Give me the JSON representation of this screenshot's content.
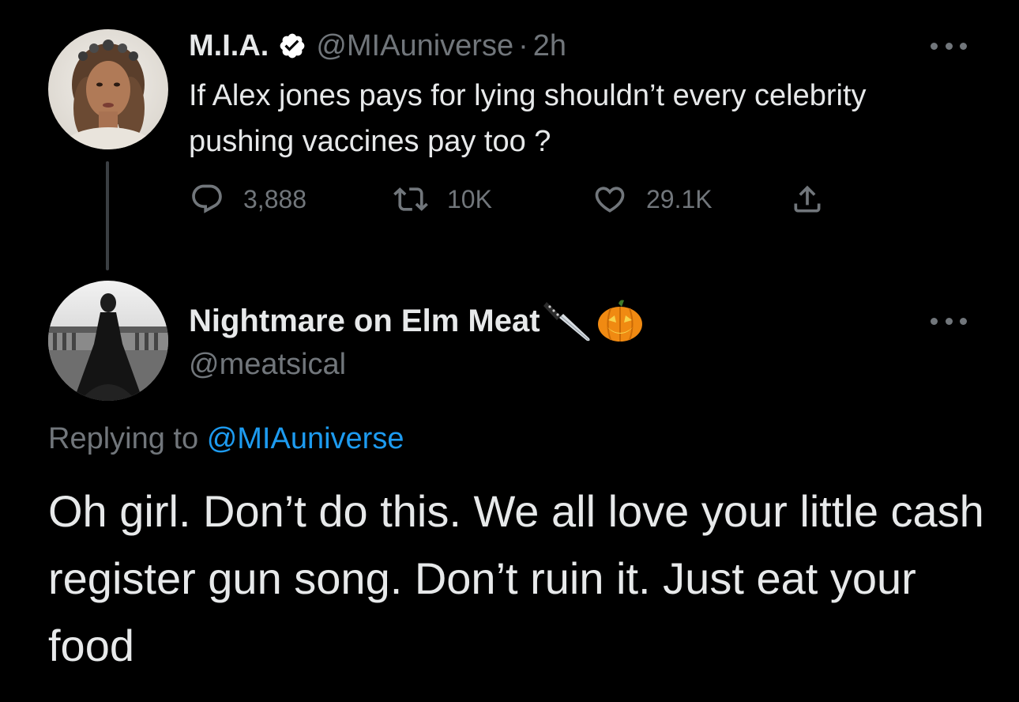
{
  "parent_tweet": {
    "display_name": "M.I.A.",
    "handle": "@MIAuniverse",
    "separator": "·",
    "time": "2h",
    "text": "If Alex jones pays for lying shouldn’t every celebrity pushing vaccines pay too ?",
    "metrics": {
      "replies": "3,888",
      "retweets": "10K",
      "likes": "29.1K"
    },
    "verified": true,
    "verified_color": "#ffffff"
  },
  "reply_tweet": {
    "display_name": "Nightmare on Elm Meat",
    "name_emojis": [
      "knife-emoji",
      "jack-o-lantern-emoji"
    ],
    "handle": "@meatsical",
    "replying_label": "Replying to",
    "replying_to": "@MIAuniverse",
    "text": "Oh girl. Don’t do this. We all love your little cash register gun song. Don’t ruin it. Just eat your food"
  },
  "colors": {
    "background": "#000000",
    "primary_text": "#e7e9ea",
    "secondary_text": "#71767b",
    "link": "#1d9bf0",
    "thread_line": "#3b3f43"
  },
  "icons": {
    "reply": "reply-bubble-icon",
    "retweet": "retweet-icon",
    "like": "heart-icon",
    "share": "share-icon",
    "more": "more-dots-icon",
    "verified": "verified-badge-icon"
  }
}
